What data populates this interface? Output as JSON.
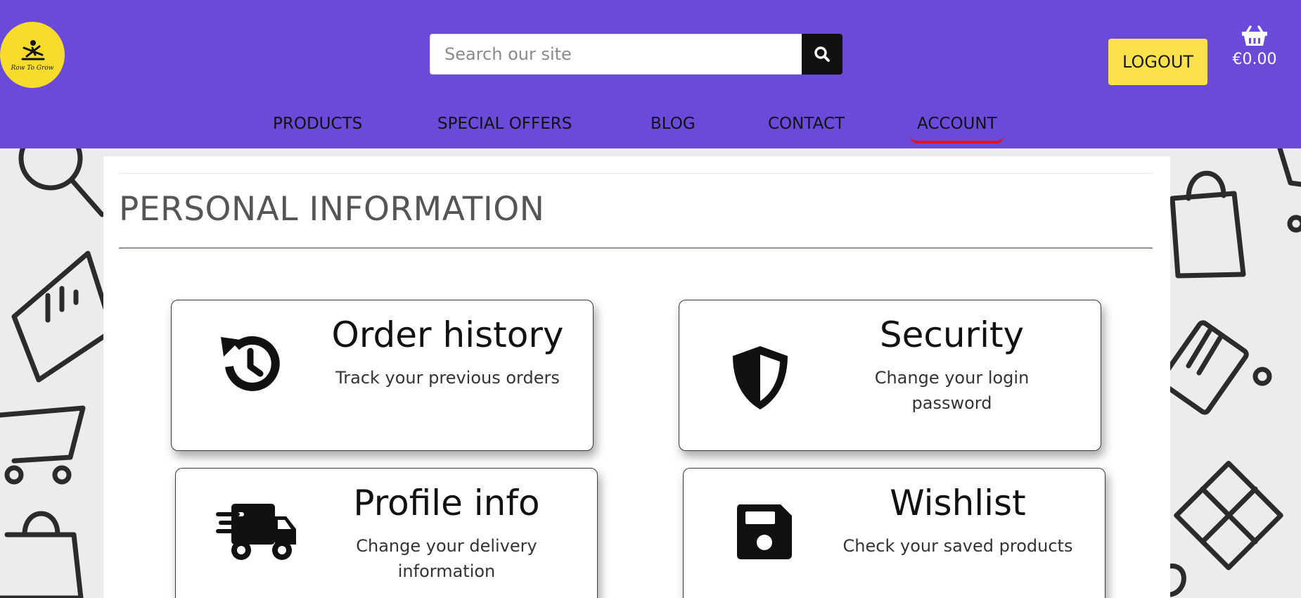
{
  "brand": {
    "logo_text": "Row To Grow",
    "colors": {
      "header": "#6a4ad8",
      "logo_bg": "#f7dc2c",
      "logout_bg": "#fbe24d",
      "active_underline": "#e8121c"
    }
  },
  "search": {
    "placeholder": "Search our site",
    "value": "",
    "button_icon": "search-icon"
  },
  "header": {
    "logout_label": "LOGOUT",
    "cart_icon": "basket-icon",
    "cart_total": "€0.00"
  },
  "nav": {
    "items": [
      {
        "label": "PRODUCTS",
        "active": false
      },
      {
        "label": "SPECIAL OFFERS",
        "active": false
      },
      {
        "label": "BLOG",
        "active": false
      },
      {
        "label": "CONTACT",
        "active": false
      },
      {
        "label": "ACCOUNT",
        "active": true
      }
    ]
  },
  "main": {
    "title": "PERSONAL INFORMATION",
    "cards": [
      {
        "icon": "history-icon",
        "title": "Order history",
        "desc": "Track your previous orders"
      },
      {
        "icon": "shield-icon",
        "title": "Security",
        "desc": "Change your login password"
      },
      {
        "icon": "truck-icon",
        "title": "Profile info",
        "desc": "Change your delivery information"
      },
      {
        "icon": "floppy-disk-icon",
        "title": "Wishlist",
        "desc": "Check your saved products"
      }
    ]
  }
}
